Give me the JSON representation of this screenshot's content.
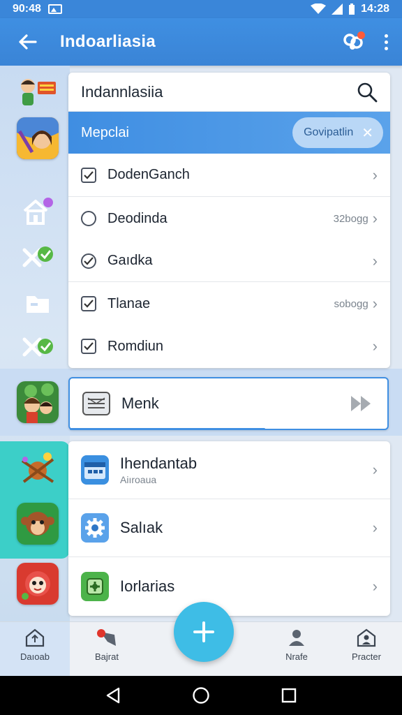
{
  "status_bar": {
    "time": "90:48",
    "clock_right": "14:28"
  },
  "app_bar": {
    "title": "Indoarliasia"
  },
  "search": {
    "query": "Indannlasiia"
  },
  "filter_row": {
    "label": "Mepclai",
    "chip_label": "Govipatlin"
  },
  "list_items": [
    {
      "label": "DodenGanch",
      "checked": true,
      "meta": ""
    },
    {
      "label": "Deodinda",
      "checked": false,
      "meta": "32bogg"
    },
    {
      "label": "Gaıdka",
      "checked": true,
      "meta": ""
    },
    {
      "label": "Tlanae",
      "checked": true,
      "meta": "sobogg"
    },
    {
      "label": "Romdiun",
      "checked": true,
      "meta": ""
    }
  ],
  "selected_item": {
    "label": "Menk"
  },
  "lower_items": [
    {
      "label": "Ihendantab",
      "sub": "Aiıroaua",
      "icon": "calendar-icon",
      "color": "#3a8fe0"
    },
    {
      "label": "Salıak",
      "sub": "",
      "icon": "settings-gear-icon",
      "color": "#3a8fe0"
    },
    {
      "label": "Iorlarias",
      "sub": "",
      "icon": "puzzle-icon",
      "color": "#4cb34a"
    }
  ],
  "bottom_nav": [
    {
      "label": "Daıoab",
      "icon": "home-upload-icon"
    },
    {
      "label": "Bajrat",
      "icon": "pin-icon"
    },
    {
      "label": "Nrafe",
      "icon": "person-icon"
    },
    {
      "label": "Practer",
      "icon": "house-person-icon"
    }
  ],
  "colors": {
    "primary": "#3a86d9",
    "fab": "#3ebde6",
    "teal": "#3ccfc8"
  }
}
